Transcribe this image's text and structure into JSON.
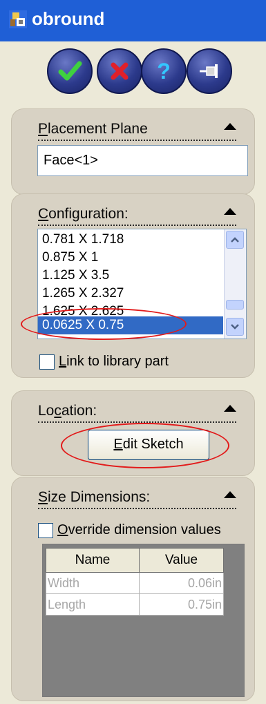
{
  "titlebar": {
    "title": "obround",
    "icon": "feature-tree-icon"
  },
  "toolbar": {
    "ok_icon": "checkmark-icon",
    "cancel_icon": "x-icon",
    "help_icon": "question-icon",
    "pin_icon": "pushpin-icon"
  },
  "placement": {
    "label_first": "P",
    "label_rest": "lacement Plane",
    "value": "Face<1>"
  },
  "configuration": {
    "label_first": "C",
    "label_rest": "onfiguration:",
    "items": [
      "0.781 X 1.718",
      "0.875 X 1",
      "1.125 X 3.5",
      "1.265 X 2.327",
      "1.625 X 2.625",
      "0.0625 X 0.75"
    ],
    "selected_index": 5,
    "link_label_first": "L",
    "link_label_rest": "ink to library part",
    "link_checked": false
  },
  "location": {
    "label_pre": "Lo",
    "label_u": "c",
    "label_rest": "ation:",
    "button_first": "E",
    "button_rest": "dit Sketch"
  },
  "size": {
    "label_first": "S",
    "label_rest": "ize Dimensions:",
    "override_first": "O",
    "override_rest": "verride dimension values",
    "override_checked": false,
    "columns": [
      "Name",
      "Value"
    ],
    "rows": [
      {
        "name": "Width",
        "value": "0.06in"
      },
      {
        "name": "Length",
        "value": "0.75in"
      }
    ]
  },
  "colors": {
    "titlebar": "#1f5fd6",
    "selection": "#316ac5",
    "annotation": "#e21b1b"
  }
}
